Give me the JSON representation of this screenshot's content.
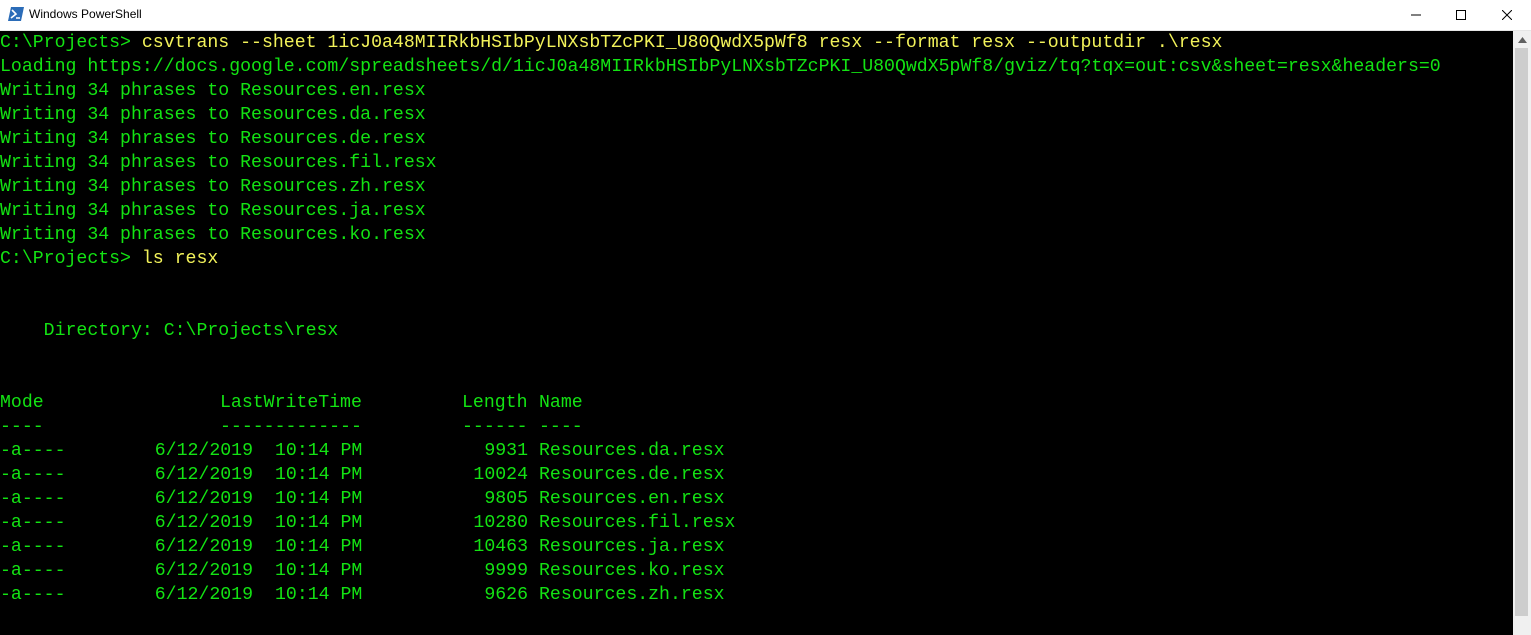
{
  "window": {
    "title": "Windows PowerShell",
    "minimize_icon": "minimize-icon",
    "maximize_icon": "maximize-icon",
    "close_icon": "close-icon"
  },
  "colors": {
    "terminal_bg": "#000000",
    "output_text": "#13e313",
    "command_text": "#f2f25a"
  },
  "terminal": {
    "prompt": "C:\\Projects> ",
    "command1": "csvtrans --sheet 1icJ0a48MIIRkbHSIbPyLNXsbTZcPKI_U80QwdX5pWf8 resx --format resx --outputdir .\\resx",
    "loading": "Loading https://docs.google.com/spreadsheets/d/1icJ0a48MIIRkbHSIbPyLNXsbTZcPKI_U80QwdX5pWf8/gviz/tq?tqx=out:csv&sheet=resx&headers=0",
    "writing": [
      "Writing 34 phrases to Resources.en.resx",
      "Writing 34 phrases to Resources.da.resx",
      "Writing 34 phrases to Resources.de.resx",
      "Writing 34 phrases to Resources.fil.resx",
      "Writing 34 phrases to Resources.zh.resx",
      "Writing 34 phrases to Resources.ja.resx",
      "Writing 34 phrases to Resources.ko.resx"
    ],
    "prompt2": "C:\\Projects> ",
    "command2": "ls resx",
    "directory": "    Directory: C:\\Projects\\resx",
    "headers": {
      "mode": "Mode",
      "lastwritetime": "LastWriteTime",
      "length": "Length",
      "name": "Name"
    },
    "separators": {
      "mode": "----",
      "lastwritetime": "-------------",
      "length": "------",
      "name": "----"
    },
    "files": [
      {
        "mode": "-a----",
        "date": "6/12/2019",
        "time": "10:14 PM",
        "length": "9931",
        "name": "Resources.da.resx"
      },
      {
        "mode": "-a----",
        "date": "6/12/2019",
        "time": "10:14 PM",
        "length": "10024",
        "name": "Resources.de.resx"
      },
      {
        "mode": "-a----",
        "date": "6/12/2019",
        "time": "10:14 PM",
        "length": "9805",
        "name": "Resources.en.resx"
      },
      {
        "mode": "-a----",
        "date": "6/12/2019",
        "time": "10:14 PM",
        "length": "10280",
        "name": "Resources.fil.resx"
      },
      {
        "mode": "-a----",
        "date": "6/12/2019",
        "time": "10:14 PM",
        "length": "10463",
        "name": "Resources.ja.resx"
      },
      {
        "mode": "-a----",
        "date": "6/12/2019",
        "time": "10:14 PM",
        "length": "9999",
        "name": "Resources.ko.resx"
      },
      {
        "mode": "-a----",
        "date": "6/12/2019",
        "time": "10:14 PM",
        "length": "9626",
        "name": "Resources.zh.resx"
      }
    ]
  }
}
